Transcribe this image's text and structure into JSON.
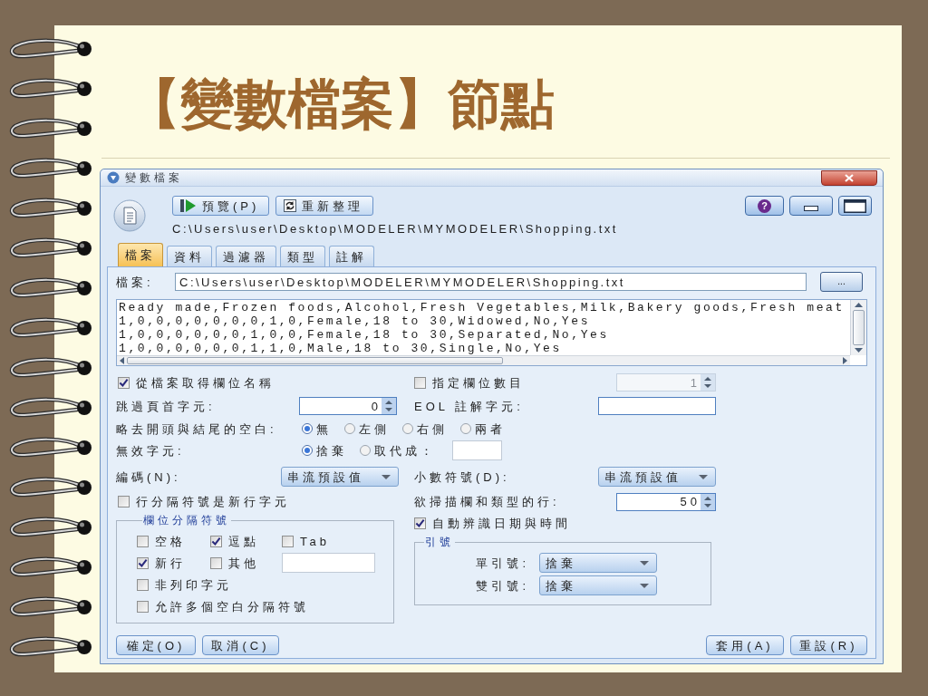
{
  "slide": {
    "title": "【變數檔案】節點"
  },
  "dialog": {
    "title": "變數檔案",
    "toolbar": [
      {
        "kind": "preview",
        "label": "預覽(P)"
      },
      {
        "kind": "refresh",
        "label": "重新整理"
      }
    ],
    "help_button": "?",
    "path": "C:\\Users\\user\\Desktop\\MODELER\\MYMODELER\\Shopping.txt",
    "tabs": [
      {
        "label": "檔案",
        "selected": true
      },
      {
        "label": "資料",
        "selected": false
      },
      {
        "label": "過濾器",
        "selected": false
      },
      {
        "label": "類型",
        "selected": false
      },
      {
        "label": "註解",
        "selected": false
      }
    ],
    "file": {
      "label": "檔案:",
      "value": "C:\\Users\\user\\Desktop\\MODELER\\MYMODELER\\Shopping.txt",
      "browse_button": "..."
    },
    "preview_lines": [
      "Ready made,Frozen foods,Alcohol,Fresh Vegetables,Milk,Bakery goods,Fresh meat",
      "1,0,0,0,0,0,0,0,1,0,Female,18 to 30,Widowed,No,Yes",
      "1,0,0,0,0,0,0,1,0,0,Female,18 to 30,Separated,No,Yes",
      "1,0,0,0,0,0,0,1,1,0,Male,18 to 30,Single,No,Yes"
    ],
    "get_field_names": {
      "label": "從檔案取得欄位名稱",
      "checked": true
    },
    "specify_field_count": {
      "label": "指定欄位數目",
      "checked": false,
      "value": "1"
    },
    "skip_header": {
      "label": "跳過頁首字元:",
      "value": "0"
    },
    "eol_comment": {
      "label": "EOL 註解字元:"
    },
    "strip_spaces": {
      "label": "略去開頭與結尾的空白:",
      "options": [
        {
          "label": "無",
          "selected": true
        },
        {
          "label": "左側",
          "selected": false
        },
        {
          "label": "右側",
          "selected": false
        },
        {
          "label": "兩者",
          "selected": false
        }
      ]
    },
    "invalid_chars": {
      "label": "無效字元:",
      "options": [
        {
          "label": "捨棄",
          "selected": true
        },
        {
          "label": "取代成：",
          "selected": false
        }
      ]
    },
    "encoding": {
      "label": "編碼(N):",
      "value": "串流預設值"
    },
    "decimal_symbol": {
      "label": "小數符號(D):",
      "value": "串流預設值"
    },
    "line_delimiter": {
      "label": "行分隔符號是新行字元",
      "checked": false
    },
    "scan_lines": {
      "label": "欲掃描欄和類型的行:",
      "value": "50"
    },
    "auto_date_time": {
      "label": "自動辨識日期與時間",
      "checked": true
    },
    "field_delimiters": {
      "title": "欄位分隔符號",
      "rows": [
        [
          {
            "kind": "checkbox",
            "label": "空格",
            "checked": false
          },
          {
            "kind": "checkbox",
            "label": "逗點",
            "checked": true
          },
          {
            "kind": "checkbox",
            "label": "Tab",
            "checked": false
          }
        ],
        [
          {
            "kind": "checkbox",
            "label": "新行",
            "checked": true
          },
          {
            "kind": "checkbox_with_field",
            "label": "其他",
            "checked": false
          }
        ],
        [
          {
            "kind": "checkbox",
            "label": "非列印字元",
            "checked": false
          }
        ],
        [
          {
            "kind": "checkbox",
            "label": "允許多個空白分隔符號",
            "checked": false
          }
        ]
      ]
    },
    "quotes": {
      "title": "引號",
      "items": [
        {
          "label": "單引號:",
          "value": "捨棄"
        },
        {
          "label": "雙引號:",
          "value": "捨棄"
        }
      ]
    },
    "footer_left": [
      "確定(O)",
      "取消(C)"
    ],
    "footer_right": [
      "套用(A)",
      "重設(R)"
    ]
  }
}
